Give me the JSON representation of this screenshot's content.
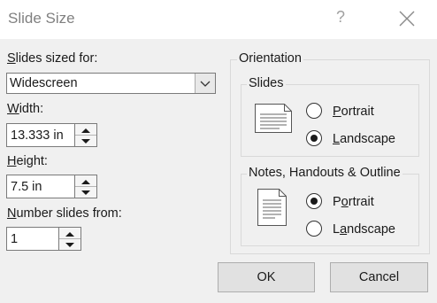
{
  "dialog": {
    "title": "Slide Size",
    "help_label": "?"
  },
  "slides_sized_for": {
    "label_access": "S",
    "label_rest": "lides sized for:",
    "value": "Widescreen"
  },
  "width": {
    "label_access": "W",
    "label_rest": "idth:",
    "value": "13.333 in"
  },
  "height": {
    "label_access": "H",
    "label_rest": "eight:",
    "value": "7.5 in"
  },
  "number_slides_from": {
    "label_access": "N",
    "label_rest": "umber slides from:",
    "value": "1"
  },
  "orientation": {
    "title": "Orientation",
    "slides": {
      "title": "Slides",
      "portrait_access": "P",
      "portrait_rest": "ortrait",
      "landscape_access": "L",
      "landscape_rest": "andscape",
      "selected": "landscape"
    },
    "notes": {
      "title": "Notes, Handouts & Outline",
      "portrait_access": "o",
      "portrait_pre": "P",
      "portrait_rest": "rtrait",
      "landscape_pre": "L",
      "landscape_access": "a",
      "landscape_rest": "ndscape",
      "selected": "portrait"
    }
  },
  "buttons": {
    "ok": "OK",
    "cancel": "Cancel"
  },
  "icons": {
    "close": "close-icon",
    "dropdown": "chevron-down-icon",
    "spin_up": "spin-up-icon",
    "spin_down": "spin-down-icon",
    "slide_landscape": "landscape-page-icon",
    "slide_portrait": "portrait-page-icon"
  }
}
